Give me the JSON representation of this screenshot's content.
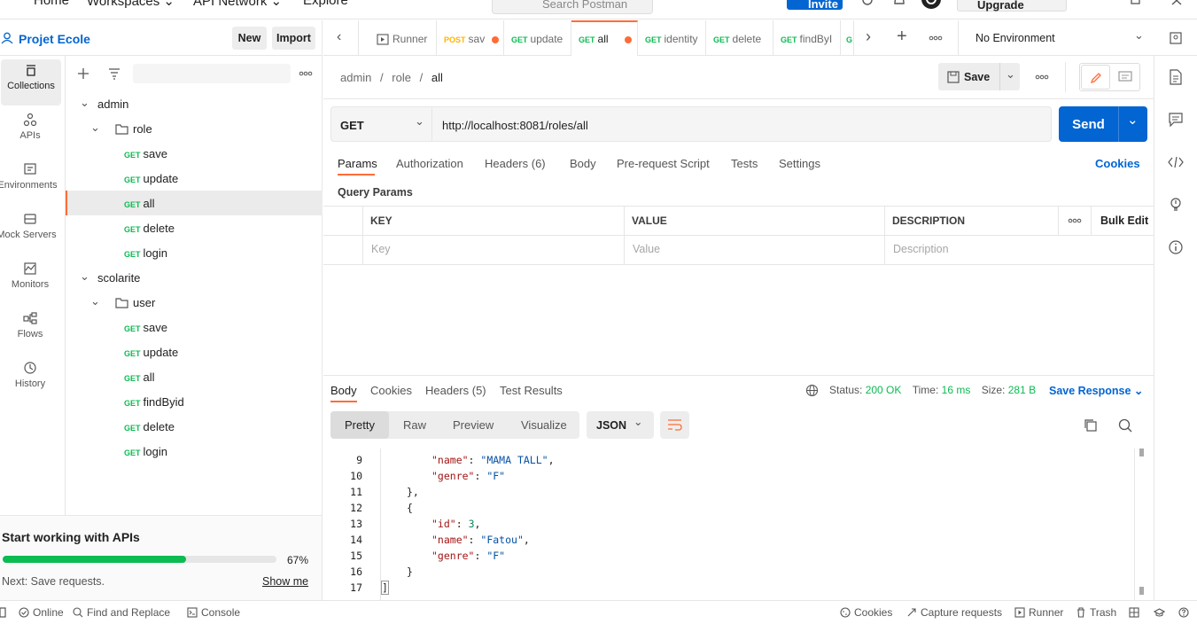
{
  "topbar": {
    "nav": [
      "Home",
      "Workspaces",
      "API Network",
      "Explore"
    ],
    "search_placeholder": "Search Postman",
    "invite_label": "Invite",
    "upgrade_label": "Upgrade"
  },
  "workspace": {
    "title": "Projet Ecole",
    "new_label": "New",
    "import_label": "Import"
  },
  "rail": [
    {
      "label": "Collections",
      "icon": "collections-icon"
    },
    {
      "label": "APIs",
      "icon": "apis-icon"
    },
    {
      "label": "Environments",
      "icon": "environments-icon"
    },
    {
      "label": "Mock Servers",
      "icon": "mock-servers-icon"
    },
    {
      "label": "Monitors",
      "icon": "monitors-icon"
    },
    {
      "label": "Flows",
      "icon": "flows-icon"
    },
    {
      "label": "History",
      "icon": "history-icon"
    }
  ],
  "tree": {
    "admin": {
      "label": "admin",
      "folder": "role",
      "requests": [
        {
          "method": "GET",
          "name": "save"
        },
        {
          "method": "GET",
          "name": "update"
        },
        {
          "method": "GET",
          "name": "all"
        },
        {
          "method": "GET",
          "name": "delete"
        },
        {
          "method": "GET",
          "name": "login"
        }
      ]
    },
    "scolarite": {
      "label": "scolarite",
      "folder": "user",
      "requests": [
        {
          "method": "GET",
          "name": "save"
        },
        {
          "method": "GET",
          "name": "update"
        },
        {
          "method": "GET",
          "name": "all"
        },
        {
          "method": "GET",
          "name": "findByid"
        },
        {
          "method": "GET",
          "name": "delete"
        },
        {
          "method": "GET",
          "name": "login"
        }
      ]
    }
  },
  "promo": {
    "title": "Start working with APIs",
    "progress_percent": 67,
    "progress_text": "67%",
    "next": "Next: Save requests.",
    "show_me": "Show me"
  },
  "tabs": [
    {
      "method": "",
      "name": "Runner"
    },
    {
      "method": "POST",
      "name": "sav"
    },
    {
      "method": "GET",
      "name": "update"
    },
    {
      "method": "GET",
      "name": "all"
    },
    {
      "method": "GET",
      "name": "identity"
    },
    {
      "method": "GET",
      "name": "delete"
    },
    {
      "method": "GET",
      "name": "findByI"
    },
    {
      "method": "G",
      "name": ""
    }
  ],
  "environment": "No Environment",
  "breadcrumb": [
    "admin",
    "role",
    "all"
  ],
  "save_label": "Save",
  "request": {
    "method": "GET",
    "url": "http://localhost:8081/roles/all",
    "send_label": "Send"
  },
  "request_tabs": [
    "Params",
    "Authorization",
    "Headers (6)",
    "Body",
    "Pre-request Script",
    "Tests",
    "Settings"
  ],
  "cookies_label": "Cookies",
  "query_params": {
    "title": "Query Params",
    "headers": [
      "KEY",
      "VALUE",
      "DESCRIPTION"
    ],
    "bulk_edit": "Bulk Edit",
    "placeholders": [
      "Key",
      "Value",
      "Description"
    ]
  },
  "response": {
    "tabs": [
      "Body",
      "Cookies",
      "Headers (5)",
      "Test Results"
    ],
    "status_label": "Status:",
    "status_value": "200 OK",
    "time_label": "Time:",
    "time_value": "16 ms",
    "size_label": "Size:",
    "size_value": "281 B",
    "save_response": "Save Response",
    "view_tabs": [
      "Pretty",
      "Raw",
      "Preview",
      "Visualize"
    ],
    "format": "JSON"
  },
  "code_lines": [
    {
      "n": "9",
      "text": "\"name\": \"MAMA TALL\","
    },
    {
      "n": "10",
      "text": "\"genre\": \"F\""
    },
    {
      "n": "11",
      "text": "},"
    },
    {
      "n": "12",
      "text": "{"
    },
    {
      "n": "13",
      "text": "\"id\": 3,"
    },
    {
      "n": "14",
      "text": "\"name\": \"Fatou\","
    },
    {
      "n": "15",
      "text": "\"genre\": \"F\""
    },
    {
      "n": "16",
      "text": "}"
    },
    {
      "n": "17",
      "text": "]"
    }
  ],
  "statusbar": {
    "online": "Online",
    "find_replace": "Find and Replace",
    "console": "Console",
    "cookies": "Cookies",
    "capture": "Capture requests",
    "runner": "Runner",
    "trash": "Trash"
  },
  "colors": {
    "accent": "#ff6c37",
    "primary": "#0265d2",
    "get_method": "#0cbb52",
    "post_method": "#ffb400",
    "status_ok": "#0cbb52",
    "progress": "#0cbb52"
  }
}
